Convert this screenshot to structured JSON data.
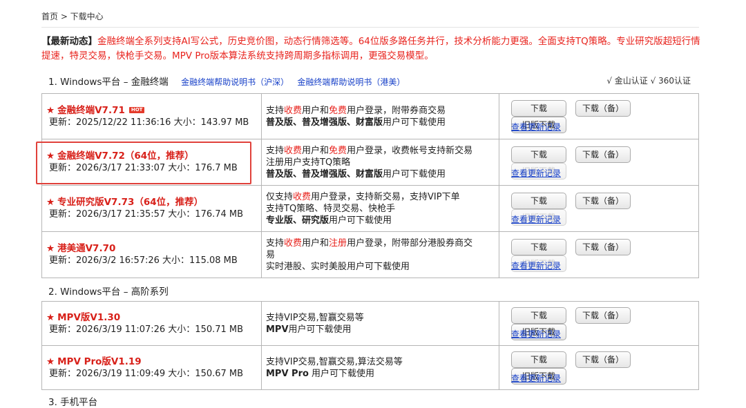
{
  "breadcrumb": "首页 > 下载中心",
  "news": {
    "label": "【最新动态】",
    "text": "金融终端全系列支持AI写公式，历史竞价图，动态行情筛选等。64位版多路任务并行，技术分析能力更强。全面支持TQ策略。专业研究版超短行情提速，特灵交易，快枪手交易。MPV Pro版本算法系统支持跨周期多指标调用，更强交易模型。"
  },
  "section1": {
    "title": "1. Windows平台 – 金融终端",
    "link1": "金融终端帮助说明书（沪深）",
    "link2": "金融终端帮助说明书（港美）",
    "certs": "√ 金山认证 √ 360认证"
  },
  "section2": {
    "title": "2. Windows平台 – 高阶系列"
  },
  "section3": {
    "title": "3. 手机平台"
  },
  "buttons": {
    "download": "下载",
    "backup": "下载（备）",
    "old": "旧版下载",
    "changelog": "查看更新记录"
  },
  "hot_badge": "HOT",
  "star": "★",
  "rows": [
    {
      "name": "金融终端V7.71",
      "update": "更新：2025/12/22 11:36:16 大小：143.97 MB",
      "desc1_a": "支持",
      "desc1_r1": "收费",
      "desc1_b": "用户和",
      "desc1_r2": "免费",
      "desc1_c": "用户登录，附带券商交易",
      "desc2_bold": "普及版、普及增强版、财富版",
      "desc2_rest": "用户可下载使用"
    },
    {
      "name": "金融终端V7.72（64位，推荐）",
      "update": "更新：2026/3/17 21:33:07 大小：176.7 MB",
      "desc1_a": "支持",
      "desc1_r1": "收费",
      "desc1_b": "用户和",
      "desc1_r2": "免费",
      "desc1_c": "用户登录，收费帐号支持新交易",
      "desc_mid": "注册用户支持TQ策略",
      "desc2_bold": "普及版、普及增强版、财富版",
      "desc2_rest": "用户可下载使用"
    },
    {
      "name": "专业研究版V7.73（64位，推荐）",
      "update": "更新：2026/3/17 21:35:57 大小：176.74 MB",
      "desc1_a": "仅支持",
      "desc1_r1": "收费",
      "desc1_c": "用户登录，支持新交易，支持VIP下单",
      "desc_mid": "支持TQ策略、特灵交易、快枪手",
      "desc2_bold": "专业版、研究版",
      "desc2_rest": "用户可下载使用"
    },
    {
      "name": "港美通V7.70",
      "update": "更新：2026/3/2 16:57:26 大小：115.08 MB",
      "desc1_a": "支持",
      "desc1_r1": "收费",
      "desc1_b": "用户和",
      "desc1_r2": "注册",
      "desc1_c": "用户登录，附带部分港股券商交",
      "desc_mid": "易",
      "desc2": "实时港股、实时美股用户可下载使用"
    },
    {
      "name": "MPV版V1.30",
      "update": "更新：2026/3/19 11:07:26 大小：150.71 MB",
      "desc1": "支持VIP交易,智赢交易等",
      "desc2_bold": "MPV",
      "desc2_rest": "用户可下载使用"
    },
    {
      "name": "MPV Pro版V1.19",
      "update": "更新：2026/3/19 11:09:49 大小：150.67 MB",
      "desc1": "支持VIP交易,智赢交易,算法交易等",
      "desc2_bold": "MPV Pro",
      "desc2_rest": " 用户可下载使用"
    }
  ]
}
